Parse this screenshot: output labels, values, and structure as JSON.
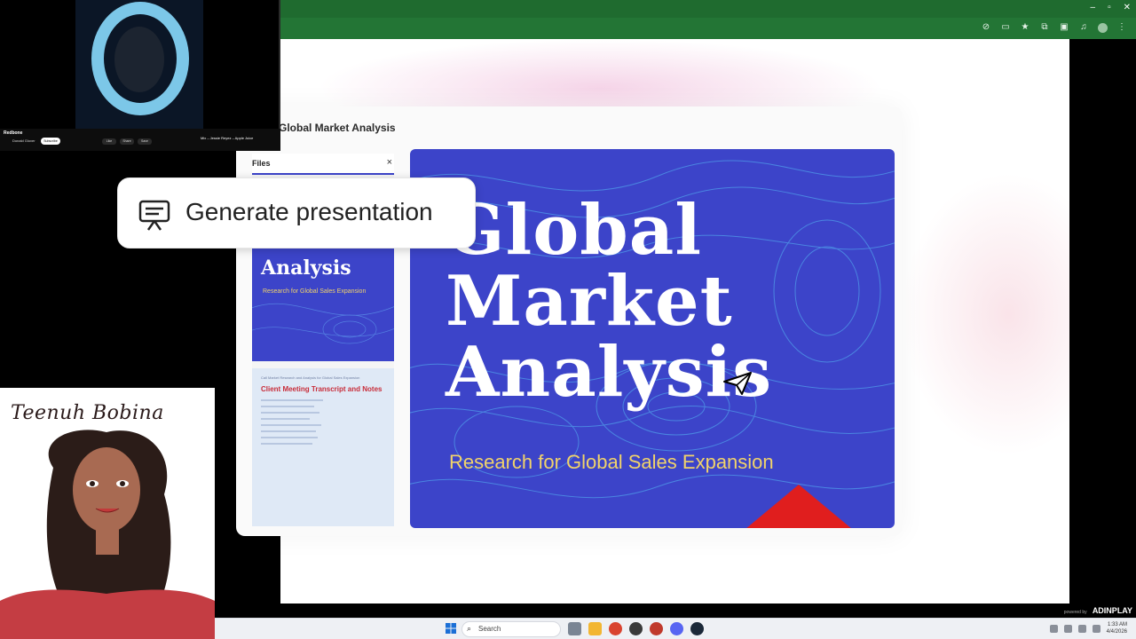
{
  "page": {
    "doc_title": "Global Market Analysis"
  },
  "files_panel": {
    "label": "Files",
    "close": "×",
    "thumb1": {
      "title": "Analysis",
      "subtitle": "Research for Global Sales Expansion"
    },
    "thumb2": {
      "small": "Call Market Research and Analysis for Global Sales Expansion",
      "heading": "Client Meeting Transcript and Notes"
    }
  },
  "slide": {
    "title_lines": [
      "Global",
      "Market",
      "Analysis"
    ],
    "subtitle": "Research for Global Sales Expansion"
  },
  "action": {
    "generate_label": "Generate presentation"
  },
  "video": {
    "song_title": "Redbone",
    "artist": "Donald Glover",
    "subscribe": "Subscribe",
    "actions": [
      "Like",
      "Share",
      "Save"
    ],
    "next_title": "Mix – Jessie Reyez – Apple Juice"
  },
  "streamer": {
    "signature": "Teenuh Bobina"
  },
  "overlay": {
    "powered_by": "powered by",
    "brand": "ADINPLAY"
  },
  "taskbar": {
    "search_label": "Search",
    "time": "1:33 AM",
    "date": "4/4/2026"
  },
  "colors": {
    "slide_bg": "#3c44c9",
    "slide_subtitle": "#f1d36a",
    "chrome_green": "#237535",
    "accent_red": "#e01e1e"
  }
}
